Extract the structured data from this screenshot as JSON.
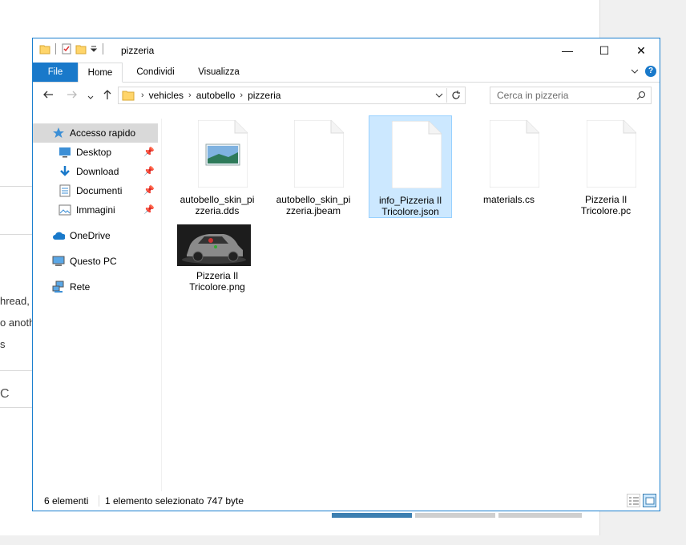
{
  "window": {
    "title": "pizzeria",
    "minimize_glyph": "—",
    "maximize_glyph": "☐",
    "close_glyph": "✕",
    "border_color": "#1a7fcf"
  },
  "ribbon": {
    "tabs": [
      {
        "label": "File"
      },
      {
        "label": "Home"
      },
      {
        "label": "Condividi"
      },
      {
        "label": "Visualizza"
      }
    ],
    "help": "?"
  },
  "address": {
    "crumbs": [
      "vehicles",
      "autobello",
      "pizzeria"
    ],
    "search_placeholder": "Cerca in pizzeria"
  },
  "sidebar": {
    "quick_access": "Accesso rapido",
    "pinned": [
      "Desktop",
      "Download",
      "Documenti",
      "Immagini"
    ],
    "onedrive": "OneDrive",
    "this_pc": "Questo PC",
    "network": "Rete"
  },
  "files": [
    {
      "name": "autobello_skin_pizzeria.dds",
      "line1": "autobello_skin_pi",
      "line2": "zzeria.dds",
      "icon": "image-file-icon"
    },
    {
      "name": "autobello_skin_pizzeria.jbeam",
      "line1": "autobello_skin_pi",
      "line2": "zzeria.jbeam",
      "icon": "generic-file-icon"
    },
    {
      "name": "info_Pizzeria Il Tricolore.json",
      "line1": "info_Pizzeria Il",
      "line2": "Tricolore.json",
      "icon": "generic-file-icon",
      "selected": true
    },
    {
      "name": "materials.cs",
      "line1": "materials.cs",
      "line2": "",
      "icon": "generic-file-icon"
    },
    {
      "name": "Pizzeria Il Tricolore.pc",
      "line1": "Pizzeria Il",
      "line2": "Tricolore.pc",
      "icon": "generic-file-icon"
    },
    {
      "name": "Pizzeria Il Tricolore.png",
      "line1": "Pizzeria Il",
      "line2": "Tricolore.png",
      "icon": "car-thumbnail"
    }
  ],
  "status": {
    "count": "6 elementi",
    "selection": "1 elemento selezionato",
    "size": "747 byte"
  },
  "background": {
    "frag1": "hread,",
    "frag2": "o anoth",
    "frag3": "s",
    "frag4": "C"
  },
  "colors": {
    "accent": "#1979ca",
    "selected_bg": "#cce8ff",
    "selected_border": "#99d1ff"
  }
}
